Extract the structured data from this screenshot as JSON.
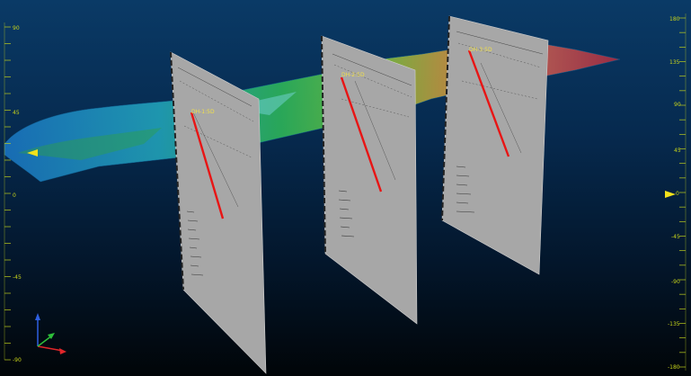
{
  "left_axis": {
    "labels": [
      "90",
      "45",
      "0",
      "-45",
      "-90"
    ],
    "marker_color": "#f4e21b"
  },
  "right_axis": {
    "labels": [
      "180",
      "135",
      "90",
      "45",
      "0",
      "-45",
      "-90",
      "-135",
      "-180"
    ],
    "marker_color": "#f4e21b"
  },
  "sections": [
    {
      "label": "DH-1:5D"
    },
    {
      "label": "DH-2:5D"
    },
    {
      "label": "DH-3:5D"
    }
  ],
  "colors": {
    "drill_trace": "#e81515",
    "tick": "#bfcf1e",
    "axis_x": "#e0262a",
    "axis_y": "#2ebf3a",
    "axis_z": "#2e5fe0"
  },
  "axis_triad": {
    "x_icon": "x-axis-arrow",
    "y_icon": "y-axis-arrow",
    "z_icon": "z-axis-arrow"
  }
}
